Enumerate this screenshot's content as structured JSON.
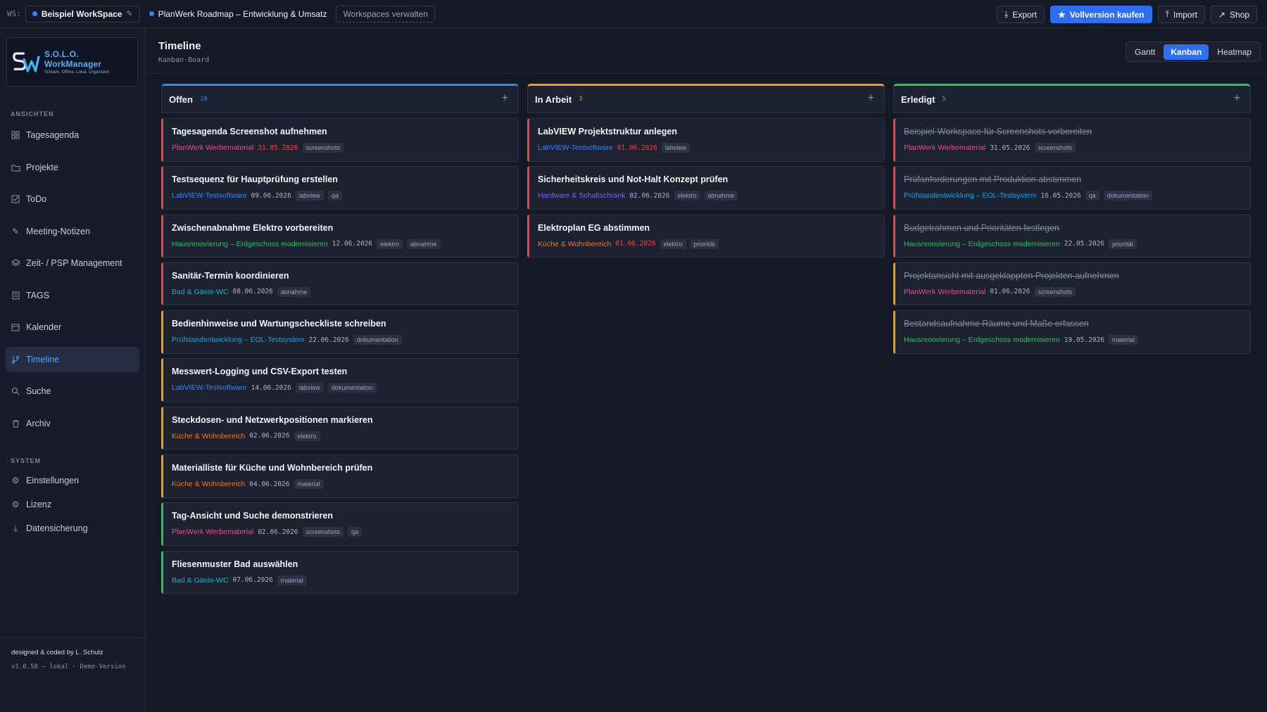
{
  "topbar": {
    "ws_label": "WS:",
    "workspace": "Beispiel WorkSpace",
    "project": "PlanWerk Roadmap – Entwicklung & Umsatz",
    "manage": "Workspaces verwalten",
    "export": "Export",
    "buy": "Vollversion kaufen",
    "import": "Import",
    "shop": "Shop"
  },
  "logo": {
    "title": "S.O.L.O. WorkManager",
    "subtitle": "Schlank. Offline. Lokal. Organisiert."
  },
  "sidebar": {
    "views_head": "ANSICHTEN",
    "items": [
      {
        "label": "Tagesagenda",
        "icon": "grid-icon"
      },
      {
        "label": "Projekte",
        "icon": "folder-icon"
      },
      {
        "label": "ToDo",
        "icon": "checkbox-icon"
      },
      {
        "label": "Meeting-Notizen",
        "icon": "pen-icon"
      },
      {
        "label": "Zeit- / PSP Management",
        "icon": "layers-icon"
      },
      {
        "label": "TAGS",
        "icon": "tag-icon"
      },
      {
        "label": "Kalender",
        "icon": "calendar-icon"
      },
      {
        "label": "Timeline",
        "icon": "timeline-icon"
      },
      {
        "label": "Suche",
        "icon": "search-icon"
      },
      {
        "label": "Archiv",
        "icon": "trash-icon"
      }
    ],
    "system_head": "SYSTEM",
    "system_items": [
      {
        "label": "Einstellungen",
        "icon": "gear-icon"
      },
      {
        "label": "Lizenz",
        "icon": "gear-icon"
      },
      {
        "label": "Datensicherung",
        "icon": "download-icon"
      }
    ],
    "credit": "designed & coded by L. Schulz",
    "version": "v1.0.58 – lokal · Demo-Version"
  },
  "header": {
    "title": "Timeline",
    "subtitle": "Kanban-Board"
  },
  "views": {
    "gantt": "Gantt",
    "kanban": "Kanban",
    "heatmap": "Heatmap"
  },
  "colors": {
    "open": "#3b82f6",
    "progress": "#f59e0b",
    "done": "#22c55e"
  },
  "columns": [
    {
      "title": "Offen",
      "count": "10",
      "color": "#3b82f6",
      "done": false,
      "cards": [
        {
          "title": "Tagesagenda Screenshot aufnehmen",
          "project": "PlanWerk Werbematerial",
          "pcolor": "#ec4899",
          "date": "31.05.2026",
          "overdue": true,
          "tags": [
            "screenshots"
          ],
          "accent": "#ef4444"
        },
        {
          "title": "Testsequenz für Hauptprüfung erstellen",
          "project": "LabVIEW-Testsoftware",
          "pcolor": "#3b82f6",
          "date": "09.06.2026",
          "overdue": false,
          "tags": [
            "labview",
            "qa"
          ],
          "accent": "#ef4444"
        },
        {
          "title": "Zwischenabnahme Elektro vorbereiten",
          "project": "Hausrenovierung – Erdgeschoss modernisieren",
          "pcolor": "#22c55e",
          "date": "12.06.2026",
          "overdue": false,
          "tags": [
            "elektro",
            "abnahme"
          ],
          "accent": "#ef4444"
        },
        {
          "title": "Sanitär-Termin koordinieren",
          "project": "Bad & Gäste-WC",
          "pcolor": "#06b6d4",
          "date": "08.06.2026",
          "overdue": false,
          "tags": [
            "abnahme"
          ],
          "accent": "#ef4444"
        },
        {
          "title": "Bedienhinweise und Wartungscheckliste schreiben",
          "project": "Prüfstandentwicklung – EOL-Testsystem",
          "pcolor": "#0ea5e9",
          "date": "22.06.2026",
          "overdue": false,
          "tags": [
            "dokumentation"
          ],
          "accent": "#f59e0b"
        },
        {
          "title": "Messwert-Logging und CSV-Export testen",
          "project": "LabVIEW-Testsoftware",
          "pcolor": "#3b82f6",
          "date": "14.06.2026",
          "overdue": false,
          "tags": [
            "labview",
            "dokumentation"
          ],
          "accent": "#f59e0b"
        },
        {
          "title": "Steckdosen- und Netzwerkpositionen markieren",
          "project": "Küche & Wohnbereich",
          "pcolor": "#f97316",
          "date": "02.06.2026",
          "overdue": false,
          "tags": [
            "elektro"
          ],
          "accent": "#f59e0b"
        },
        {
          "title": "Materialliste für Küche und Wohnbereich prüfen",
          "project": "Küche & Wohnbereich",
          "pcolor": "#f97316",
          "date": "04.06.2026",
          "overdue": false,
          "tags": [
            "material"
          ],
          "accent": "#f59e0b"
        },
        {
          "title": "Tag-Ansicht und Suche demonstrieren",
          "project": "PlanWerk Werbematerial",
          "pcolor": "#ec4899",
          "date": "02.06.2026",
          "overdue": false,
          "tags": [
            "screenshots",
            "qa"
          ],
          "accent": "#22c55e"
        },
        {
          "title": "Fliesenmuster Bad auswählen",
          "project": "Bad & Gäste-WC",
          "pcolor": "#06b6d4",
          "date": "07.06.2026",
          "overdue": false,
          "tags": [
            "material"
          ],
          "accent": "#22c55e"
        }
      ]
    },
    {
      "title": "In Arbeit",
      "count": "3",
      "color": "#f59e0b",
      "done": false,
      "cards": [
        {
          "title": "LabVIEW Projektstruktur anlegen",
          "project": "LabVIEW-Testsoftware",
          "pcolor": "#3b82f6",
          "date": "01.06.2026",
          "overdue": true,
          "tags": [
            "labview"
          ],
          "accent": "#ef4444"
        },
        {
          "title": "Sicherheitskreis und Not-Halt Konzept prüfen",
          "project": "Hardware & Schaltschrank",
          "pcolor": "#8b5cf6",
          "date": "02.06.2026",
          "overdue": false,
          "tags": [
            "elektro",
            "abnahme"
          ],
          "accent": "#ef4444"
        },
        {
          "title": "Elektroplan EG abstimmen",
          "project": "Küche & Wohnbereich",
          "pcolor": "#f97316",
          "date": "01.06.2026",
          "overdue": true,
          "tags": [
            "elektro",
            "priorität"
          ],
          "accent": "#ef4444"
        }
      ]
    },
    {
      "title": "Erledigt",
      "count": "5",
      "color": "#22c55e",
      "done": true,
      "cards": [
        {
          "title": "Beispiel-Workspace für Screenshots vorbereiten",
          "project": "PlanWerk Werbematerial",
          "pcolor": "#ec4899",
          "date": "31.05.2026",
          "overdue": false,
          "tags": [
            "screenshots"
          ],
          "accent": "#ef4444"
        },
        {
          "title": "Prüfanforderungen mit Produktion abstimmen",
          "project": "Prüfstandentwicklung – EOL-Testsystem",
          "pcolor": "#0ea5e9",
          "date": "16.05.2026",
          "overdue": false,
          "tags": [
            "qa",
            "dokumentation"
          ],
          "accent": "#ef4444"
        },
        {
          "title": "Budgetrahmen und Prioritäten festlegen",
          "project": "Hausrenovierung – Erdgeschoss modernisieren",
          "pcolor": "#22c55e",
          "date": "22.05.2026",
          "overdue": false,
          "tags": [
            "priorität"
          ],
          "accent": "#ef4444"
        },
        {
          "title": "Projektansicht mit ausgeklappten Projekten aufnehmen",
          "project": "PlanWerk Werbematerial",
          "pcolor": "#ec4899",
          "date": "01.06.2026",
          "overdue": false,
          "tags": [
            "screenshots"
          ],
          "accent": "#f59e0b"
        },
        {
          "title": "Bestandsaufnahme Räume und Maße erfassen",
          "project": "Hausrenovierung – Erdgeschoss modernisieren",
          "pcolor": "#22c55e",
          "date": "19.05.2026",
          "overdue": false,
          "tags": [
            "material"
          ],
          "accent": "#f59e0b"
        }
      ]
    }
  ]
}
